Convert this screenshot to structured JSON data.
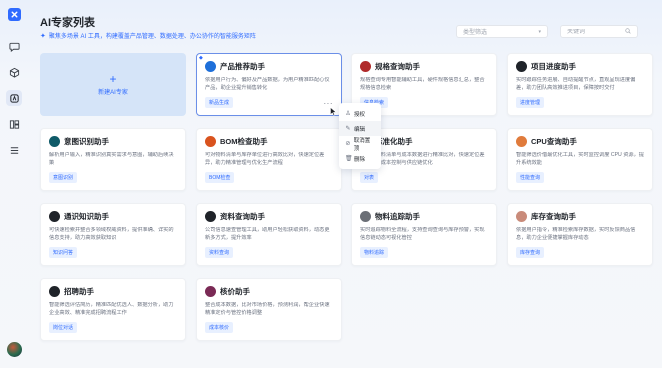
{
  "app": {
    "logo_letter": "",
    "page_title": "AI专家列表",
    "subtitle": "聚焦多场景 AI 工具，构建覆盖产品管理、数据处理、办公协作的智能服务矩阵"
  },
  "sidebar": {
    "items": [
      {
        "icon": "chat-icon"
      },
      {
        "icon": "cube-icon"
      },
      {
        "icon": "ai-agent-icon"
      },
      {
        "icon": "library-icon"
      },
      {
        "icon": "menu-icon"
      }
    ]
  },
  "toolbar": {
    "filter_placeholder": "类型筛选",
    "search_placeholder": "关键词"
  },
  "new_card": {
    "plus": "+",
    "label": "新建AI专家"
  },
  "cards": [
    {
      "title": "产品推荐助手",
      "desc": "依据用户行为、偏好及产品数据，为用户精准匹配心仪产品，助企业提升销售转化",
      "tag": "新品生成",
      "color": "#1e6fd9"
    },
    {
      "title": "规格查询助手",
      "desc": "规格查询专用智能辅助工具，硬件规格信息汇总，整合规格信息检索",
      "tag": "信息检索",
      "color": "#b02a2a"
    },
    {
      "title": "项目进度助手",
      "desc": "实时跟踪任务进展、自动提醒节点，直观呈现进度偏差，助力团队高效推进项目，保障按时交付",
      "tag": "进度管理",
      "color": "#1f2329"
    },
    {
      "title": "意图识别助手",
      "desc": "解析用户输入，精准识别真实需求与意图，辅助后续决策",
      "tag": "意图识别",
      "color": "#0f5a68"
    },
    {
      "title": "BOM检查助手",
      "desc": "可对物料清单与库存单位进行高效比对，快速定位差异，助力精准管理与优化生产流程",
      "tag": "BOM检查",
      "color": "#d9531e"
    },
    {
      "title": "标准化助手",
      "desc": "标准化物料清单与成本数据进行精准比对，快速定位差异，助力成本控制与供应链优化",
      "tag": "对表",
      "color": "#c0392b"
    },
    {
      "title": "CPU查询助手",
      "desc": "智能筛选价借最优化工具，实时监控调度 CPU 资源，提升系统效能",
      "tag": "性能查询",
      "color": "#e07b3c"
    },
    {
      "title": "通识知识助手",
      "desc": "可快速检索并整合多领域权威资料，提供准确、详实的信息支持，助力高效获取知识",
      "tag": "知识问答",
      "color": "#1f2329"
    },
    {
      "title": "资料查询助手",
      "desc": "公司信息速查管理工具，助用户轻松获取资料，动态更新多方式，提升效率",
      "tag": "资料查询",
      "color": "#1f2329"
    },
    {
      "title": "物料追踪助手",
      "desc": "实时追踪物料全流程，支持查询查询与库存预警，实现信息链动态可视化管控",
      "tag": "物料追踪",
      "color": "#6b6f76"
    },
    {
      "title": "库存查询助手",
      "desc": "依据用户指令，精准检索库存数据，实时反馈商品信息，助力企业便捷掌握库存动态",
      "tag": "库存查询",
      "color": "#c98b7a"
    },
    {
      "title": "招聘助手",
      "desc": "智能筛选评估简历，精准匹配优选人、数据分析，助力企业高效、精准完成招聘流程工作",
      "tag": "岗位对话",
      "color": "#1f2329"
    },
    {
      "title": "核价助手",
      "desc": "整合成本数据，比对市场价格，预测利润，帮企业快速精准定价与管控价格调整",
      "tag": "成本核价",
      "color": "#7a2a55"
    }
  ],
  "context_menu": {
    "items": [
      {
        "icon": "user-icon",
        "label": "授权"
      },
      {
        "icon": "edit-icon",
        "label": "编辑"
      },
      {
        "icon": "link-off-icon",
        "label": "取消置顶"
      },
      {
        "icon": "delete-icon",
        "label": "删除"
      }
    ]
  }
}
